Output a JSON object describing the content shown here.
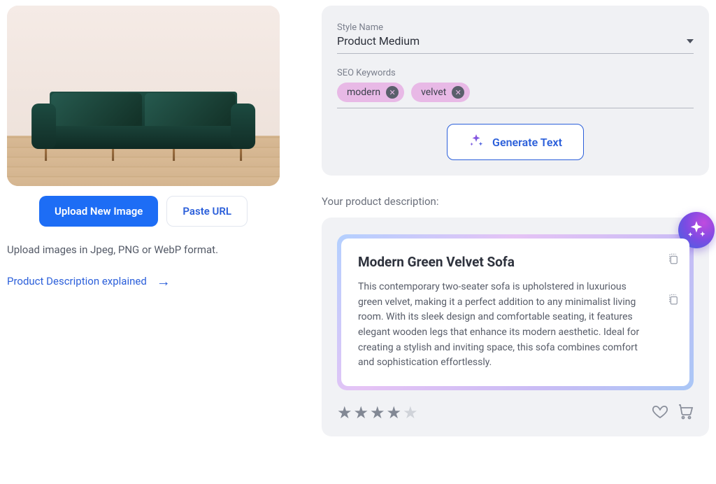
{
  "imageActions": {
    "upload_label": "Upload New Image",
    "paste_url_label": "Paste URL"
  },
  "hint": "Upload images in Jpeg, PNG or WebP format.",
  "help_link": "Product Description explained",
  "config": {
    "style_label": "Style Name",
    "style_value": "Product Medium",
    "seo_label": "SEO Keywords",
    "keywords": [
      "modern",
      "velvet"
    ],
    "generate_label": "Generate Text"
  },
  "output_section_label": "Your product description:",
  "result": {
    "title": "Modern Green Velvet Sofa",
    "body": "This contemporary two-seater sofa is upholstered in luxurious green velvet, making it a perfect addition to any minimalist living room. With its sleek design and comfortable seating, it features elegant wooden legs that enhance its modern aesthetic. Ideal for creating a stylish and inviting space, this sofa combines comfort and sophistication effortlessly."
  },
  "rating": {
    "value": 4,
    "max": 5
  }
}
